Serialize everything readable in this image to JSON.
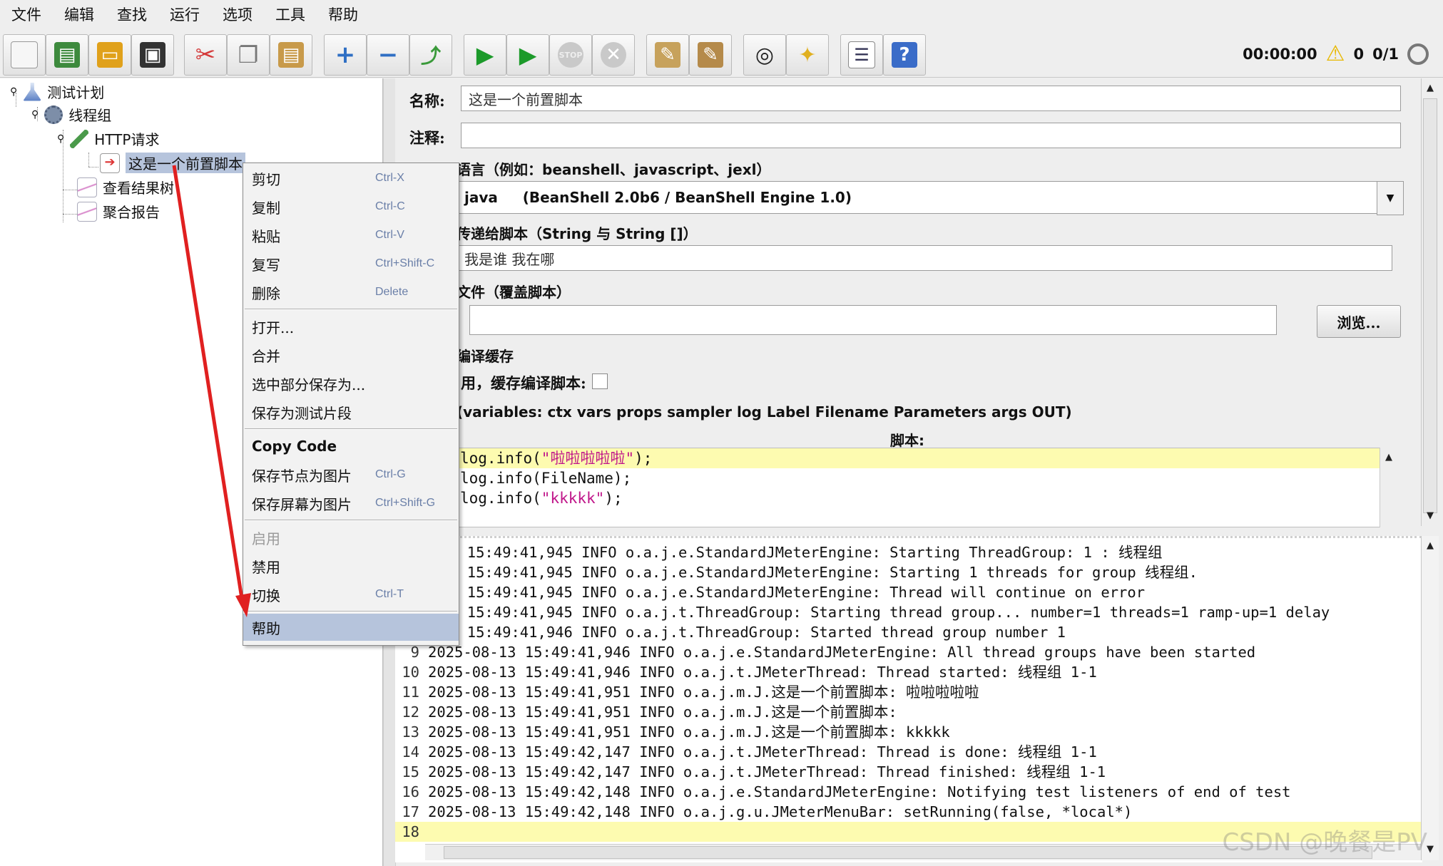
{
  "menubar": [
    "文件",
    "编辑",
    "查找",
    "运行",
    "选项",
    "工具",
    "帮助"
  ],
  "toolbar": {
    "buttons": [
      {
        "name": "new-icon",
        "color": "#f4f4f4",
        "glyph": ""
      },
      {
        "name": "templates-icon",
        "color": "#3d8a3d",
        "glyph": "▤"
      },
      {
        "name": "open-icon",
        "color": "#e0a11b",
        "glyph": "▭"
      },
      {
        "name": "save-icon",
        "color": "#333333",
        "glyph": "▣"
      },
      {
        "name": "cut-icon",
        "color": "#d43a3a",
        "glyph": "✂"
      },
      {
        "name": "copy-icon",
        "color": "#cfcfcf",
        "glyph": "❐"
      },
      {
        "name": "paste-icon",
        "color": "#c89a4a",
        "glyph": "▤"
      },
      {
        "name": "expand-icon",
        "color": "#ffffff",
        "glyph": "+"
      },
      {
        "name": "collapse-icon",
        "color": "#ffffff",
        "glyph": "−"
      },
      {
        "name": "toggle-icon",
        "color": "#ffffff",
        "glyph": "⤴"
      },
      {
        "name": "start-icon",
        "color": "#ffffff",
        "glyph": "▶"
      },
      {
        "name": "start-no-pauses-icon",
        "color": "#ffffff",
        "glyph": "▶"
      },
      {
        "name": "stop-icon",
        "color": "#c9c9c9",
        "glyph": "⬣"
      },
      {
        "name": "shutdown-icon",
        "color": "#c9c9c9",
        "glyph": "✕"
      },
      {
        "name": "clear-icon",
        "color": "#b58a4a",
        "glyph": "✎"
      },
      {
        "name": "clear-all-icon",
        "color": "#b58a4a",
        "glyph": "✎"
      },
      {
        "name": "search-icon",
        "color": "#222222",
        "glyph": "◎"
      },
      {
        "name": "reset-search-icon",
        "color": "#e0b020",
        "glyph": "✦"
      },
      {
        "name": "function-helper-icon",
        "color": "#ffffff",
        "glyph": "☰"
      },
      {
        "name": "help-icon",
        "color": "#3a6cc8",
        "glyph": "?"
      }
    ]
  },
  "status": {
    "timer": "00:00:00",
    "warnings": "0",
    "threads": "0/1"
  },
  "tree": {
    "items": [
      {
        "label": "测试计划"
      },
      {
        "label": "线程组"
      },
      {
        "label": "HTTP请求"
      },
      {
        "label": "这是一个前置脚本"
      },
      {
        "label": "查看结果树"
      },
      {
        "label": "聚合报告"
      }
    ]
  },
  "form": {
    "name_label": "名称:",
    "name_value": "这是一个前置脚本",
    "comment_label": "注释:",
    "comment_value": "",
    "language_title": "语言（例如：beanshell、javascript、jexl）",
    "language_value": "java     (BeanShell 2.0b6 / BeanShell Engine 1.0)",
    "params_title": "传递给脚本（String 与 String []）",
    "params_value": "我是谁 我在哪",
    "file_title": "文件（覆盖脚本）",
    "file_value": "",
    "browse_label": "浏览...",
    "cache_title": "编译缓存",
    "cache_label": "用，缓存编译脚本:",
    "vars_title": "(variables: ctx vars props sampler log Label Filename Parameters args OUT)",
    "script_label": "脚本:",
    "script_lines": [
      {
        "pre": "log.info(",
        "str": "\"啦啦啦啦啦\"",
        "post": ");"
      },
      {
        "pre": "log.info(FileName);",
        "str": "",
        "post": ""
      },
      {
        "pre": "log.info(",
        "str": "\"kkkkk\"",
        "post": ");"
      }
    ]
  },
  "log": {
    "lines": [
      {
        "num": "",
        "text": "5-08-13 15:49:41,945 INFO o.a.j.e.StandardJMeterEngine: Starting ThreadGroup: 1 : 线程组"
      },
      {
        "num": "",
        "text": "5-08-13 15:49:41,945 INFO o.a.j.e.StandardJMeterEngine: Starting 1 threads for group 线程组."
      },
      {
        "num": "",
        "text": "5-08-13 15:49:41,945 INFO o.a.j.e.StandardJMeterEngine: Thread will continue on error"
      },
      {
        "num": "",
        "text": "5-08-13 15:49:41,945 INFO o.a.j.t.ThreadGroup: Starting thread group... number=1 threads=1 ramp-up=1 delay"
      },
      {
        "num": "",
        "text": "5-08-13 15:49:41,946 INFO o.a.j.t.ThreadGroup: Started thread group number 1"
      },
      {
        "num": "9",
        "text": "2025-08-13 15:49:41,946 INFO o.a.j.e.StandardJMeterEngine: All thread groups have been started"
      },
      {
        "num": "10",
        "text": "2025-08-13 15:49:41,946 INFO o.a.j.t.JMeterThread: Thread started: 线程组 1-1"
      },
      {
        "num": "11",
        "text": "2025-08-13 15:49:41,951 INFO o.a.j.m.J.这是一个前置脚本: 啦啦啦啦啦"
      },
      {
        "num": "12",
        "text": "2025-08-13 15:49:41,951 INFO o.a.j.m.J.这是一个前置脚本:"
      },
      {
        "num": "13",
        "text": "2025-08-13 15:49:41,951 INFO o.a.j.m.J.这是一个前置脚本: kkkkk"
      },
      {
        "num": "14",
        "text": "2025-08-13 15:49:42,147 INFO o.a.j.t.JMeterThread: Thread is done: 线程组 1-1"
      },
      {
        "num": "15",
        "text": "2025-08-13 15:49:42,147 INFO o.a.j.t.JMeterThread: Thread finished: 线程组 1-1"
      },
      {
        "num": "16",
        "text": "2025-08-13 15:49:42,148 INFO o.a.j.e.StandardJMeterEngine: Notifying test listeners of end of test"
      },
      {
        "num": "17",
        "text": "2025-08-13 15:49:42,148 INFO o.a.j.g.u.JMeterMenuBar: setRunning(false, *local*)"
      },
      {
        "num": "18",
        "text": ""
      }
    ]
  },
  "context_menu": {
    "items": [
      {
        "label": "剪切",
        "shortcut": "Ctrl-X"
      },
      {
        "label": "复制",
        "shortcut": "Ctrl-C"
      },
      {
        "label": "粘贴",
        "shortcut": "Ctrl-V"
      },
      {
        "label": "复写",
        "shortcut": "Ctrl+Shift-C"
      },
      {
        "label": "删除",
        "shortcut": "Delete"
      },
      {
        "label": "打开...",
        "shortcut": ""
      },
      {
        "label": "合并",
        "shortcut": ""
      },
      {
        "label": "选中部分保存为...",
        "shortcut": ""
      },
      {
        "label": "保存为测试片段",
        "shortcut": ""
      },
      {
        "label": "Copy Code",
        "shortcut": ""
      },
      {
        "label": "保存节点为图片",
        "shortcut": "Ctrl-G"
      },
      {
        "label": "保存屏幕为图片",
        "shortcut": "Ctrl+Shift-G"
      },
      {
        "label": "启用",
        "shortcut": ""
      },
      {
        "label": "禁用",
        "shortcut": ""
      },
      {
        "label": "切换",
        "shortcut": "Ctrl-T"
      },
      {
        "label": "帮助",
        "shortcut": ""
      }
    ]
  },
  "watermark": "CSDN @晚餐是PV",
  "colors": {
    "accent_arrow": "#e02020",
    "selection": "#b6c4dc",
    "highlight": "#fdfbb0"
  }
}
